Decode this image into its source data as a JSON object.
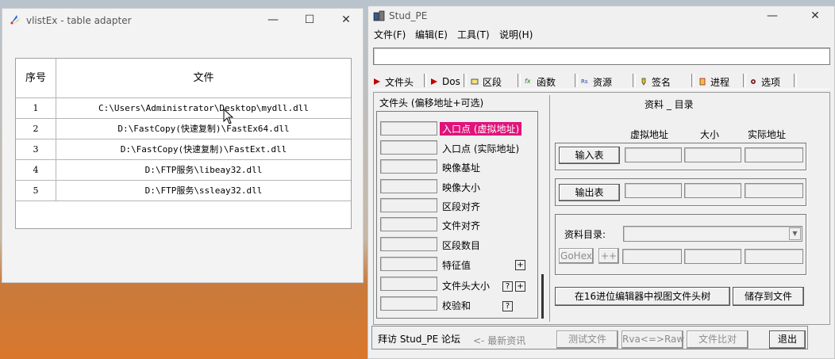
{
  "left_window": {
    "title": "vlistEx - table adapter",
    "controls": {
      "minimize": "—",
      "maximize": "☐",
      "close": "✕"
    },
    "table": {
      "columns": [
        "序号",
        "文件"
      ],
      "rows": [
        {
          "index": "1",
          "file": "C:\\Users\\Administrator\\Desktop\\mydll.dll"
        },
        {
          "index": "2",
          "file": "D:\\FastCopy(快速复制)\\FastEx64.dll"
        },
        {
          "index": "3",
          "file": "D:\\FastCopy(快速复制)\\FastExt.dll"
        },
        {
          "index": "4",
          "file": "D:\\FTP服务\\libeay32.dll"
        },
        {
          "index": "5",
          "file": "D:\\FTP服务\\ssleay32.dll"
        }
      ]
    }
  },
  "right_window": {
    "title": "Stud_PE",
    "controls": {
      "minimize": "—",
      "maximize": "☐",
      "close": "✕"
    },
    "menu": [
      "文件(F)",
      "编辑(E)",
      "工具(T)",
      "说明(H)"
    ],
    "path_value": "",
    "tabs": [
      {
        "label": "文件头",
        "icon": "pe-header-icon",
        "icon_color": "#c00000"
      },
      {
        "label": "Dos",
        "icon": "dos-icon",
        "icon_color": "#c00000"
      },
      {
        "label": "区段",
        "icon": "section-icon",
        "icon_color": "#d0b000"
      },
      {
        "label": "函数",
        "icon": "function-icon",
        "icon_color": "#208020",
        "icon_text": "fx"
      },
      {
        "label": "资源",
        "icon": "resource-icon",
        "icon_color": "#2040a0",
        "icon_text": "Rs"
      },
      {
        "label": "签名",
        "icon": "signature-icon",
        "icon_color": "#a08000"
      },
      {
        "label": "进程",
        "icon": "process-icon",
        "icon_color": "#a02020"
      },
      {
        "label": "选项",
        "icon": "options-icon",
        "icon_color": "#802020"
      }
    ],
    "header_panel": {
      "label": "文件头 (偏移地址+可选)",
      "fields": [
        {
          "label": "入口点 (虚拟地址)",
          "value": "",
          "highlighted": true
        },
        {
          "label": "入口点 (实际地址)",
          "value": ""
        },
        {
          "label": "映像基址",
          "value": ""
        },
        {
          "label": "映像大小",
          "value": ""
        },
        {
          "label": "区段对齐",
          "value": ""
        },
        {
          "label": "文件对齐",
          "value": ""
        },
        {
          "label": "区段数目",
          "value": ""
        },
        {
          "label": "特征值",
          "value": "",
          "buttons": [
            "+"
          ]
        },
        {
          "label": "文件头大小",
          "value": "",
          "buttons": [
            "?",
            "+"
          ]
        },
        {
          "label": "校验和",
          "value": "",
          "buttons": [
            "?"
          ]
        }
      ]
    },
    "directory_panel": {
      "title": "资料 _ 目录",
      "columns": [
        "虚拟地址",
        "大小",
        "实际地址"
      ],
      "import_btn": "输入表",
      "export_btn": "输出表",
      "dir_label": "资料目录:",
      "dir_select_value": "",
      "gohex_btn": "GoHex",
      "plusplus_btn": "++",
      "view_hex_btn": "在16进位编辑器中视图文件头树",
      "save_btn": "储存到文件"
    },
    "status": {
      "forum": "拜访 Stud_PE 论坛",
      "news": "<- 最新资讯",
      "test_btn": "测试文件",
      "rva_btn": "Rva<=>Raw",
      "compare_btn": "文件比对",
      "exit_btn": "退出"
    }
  },
  "colors": {
    "highlight": "#e0137a",
    "window_bg": "#f0f0f0"
  }
}
